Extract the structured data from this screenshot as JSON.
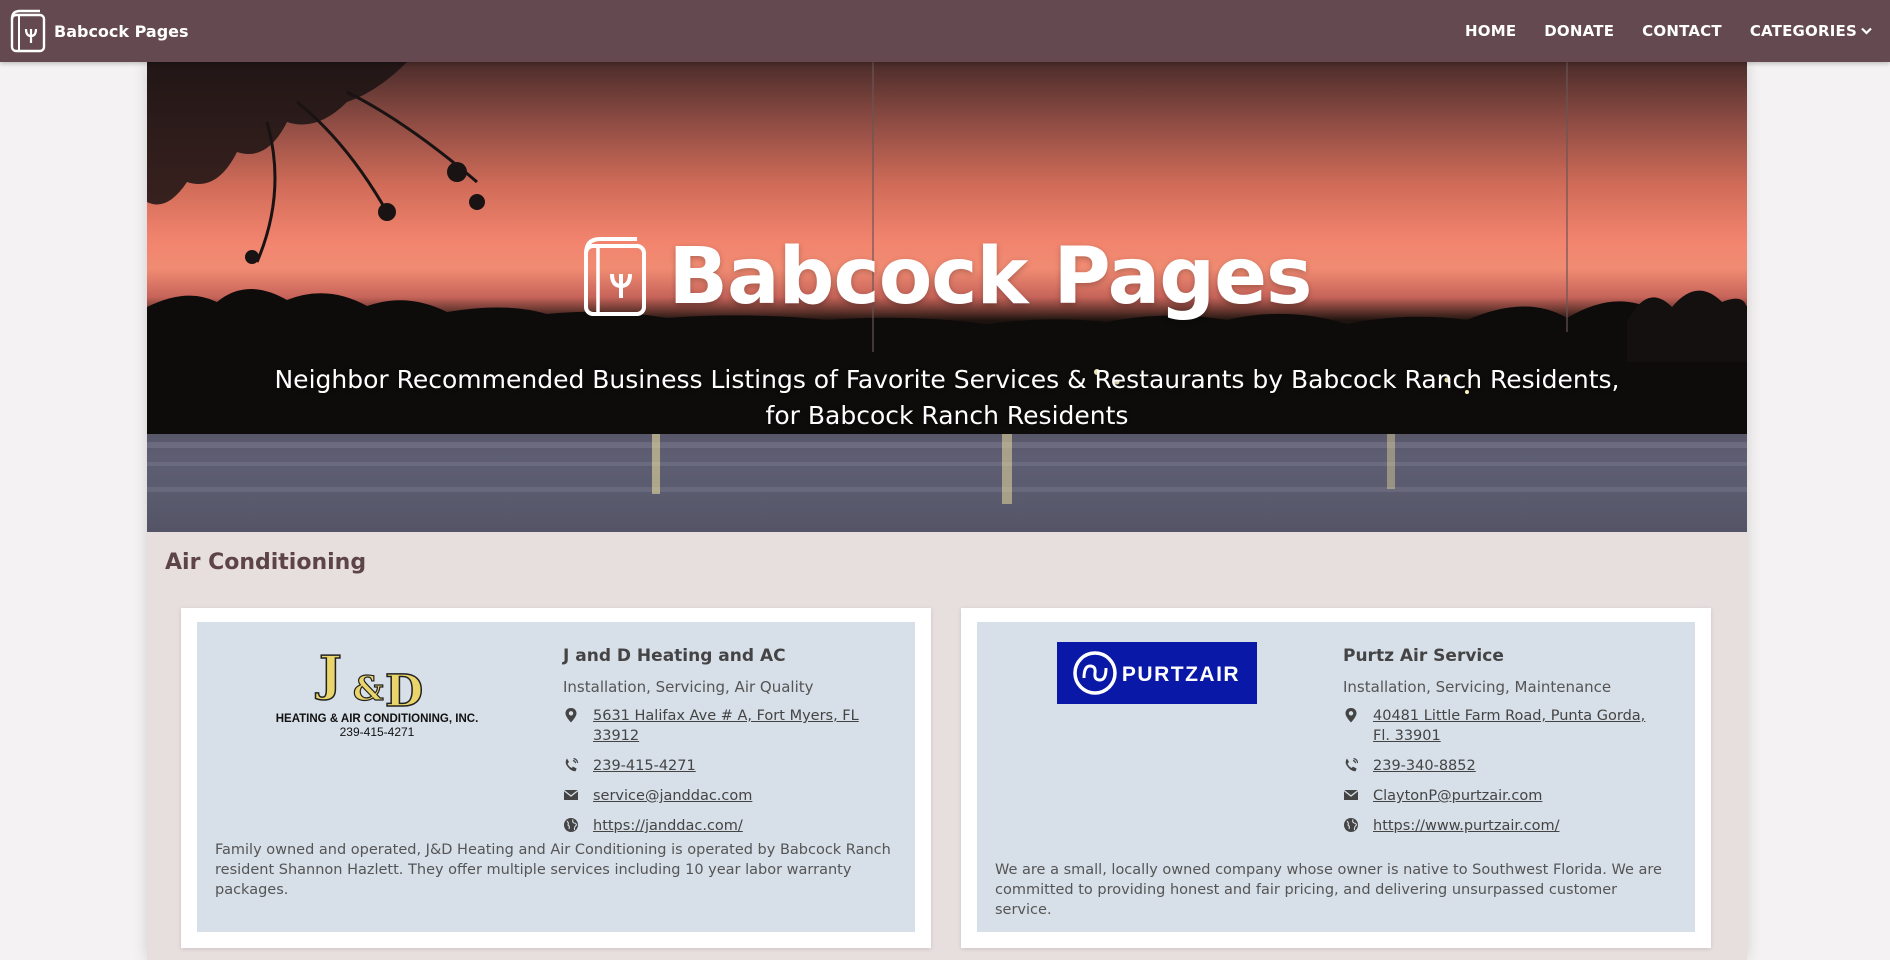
{
  "nav": {
    "brand": "Babcock Pages",
    "links": [
      "HOME",
      "DONATE",
      "CONTACT",
      "CATEGORIES"
    ]
  },
  "hero": {
    "title": "Babcock Pages",
    "subtitle": "Neighbor Recommended Business Listings of Favorite Services & Restaurants by Babcock Ranch Residents, for Babcock Ranch Residents"
  },
  "section": {
    "title": "Air Conditioning"
  },
  "listings": [
    {
      "name": "J and D Heating and AC",
      "services": "Installation, Servicing, Air Quality",
      "address": "5631 Halifax Ave # A, Fort Myers, FL 33912",
      "phone": "239-415-4271",
      "email": "service@janddac.com",
      "website": "https://janddac.com/",
      "description": "Family owned and operated, J&D Heating and Air Conditioning is operated by Babcock Ranch resident Shannon Hazlett. They offer multiple services including 10 year labor warranty packages.",
      "logo": {
        "mark_j": "J",
        "mark_amp": "&",
        "mark_d": "D",
        "line1": "HEATING & AIR CONDITIONING, INC.",
        "line2": "239-415-4271"
      }
    },
    {
      "name": "Purtz Air Service",
      "services": "Installation, Servicing, Maintenance",
      "address": "40481 Little Farm Road, Punta Gorda, Fl. 33901",
      "phone": "239-340-8852",
      "email": "ClaytonP@purtzair.com",
      "website": "https://www.purtzair.com/",
      "description": "We are a small, locally owned company whose owner is native to Southwest Florida. We are committed to providing honest and fair pricing, and delivering unsurpassed customer service.",
      "logo": {
        "text": "PURTZAIR"
      }
    }
  ],
  "icons": [
    "book-logo-icon",
    "chevron-down-icon",
    "map-marker-icon",
    "phone-icon",
    "envelope-icon",
    "globe-icon"
  ],
  "colors": {
    "navbar": "#644a50",
    "page": "#e7dede",
    "card": "#d7dfe8",
    "purtz_blue": "#0a18a8",
    "jd_gold": "#e9d56a"
  }
}
